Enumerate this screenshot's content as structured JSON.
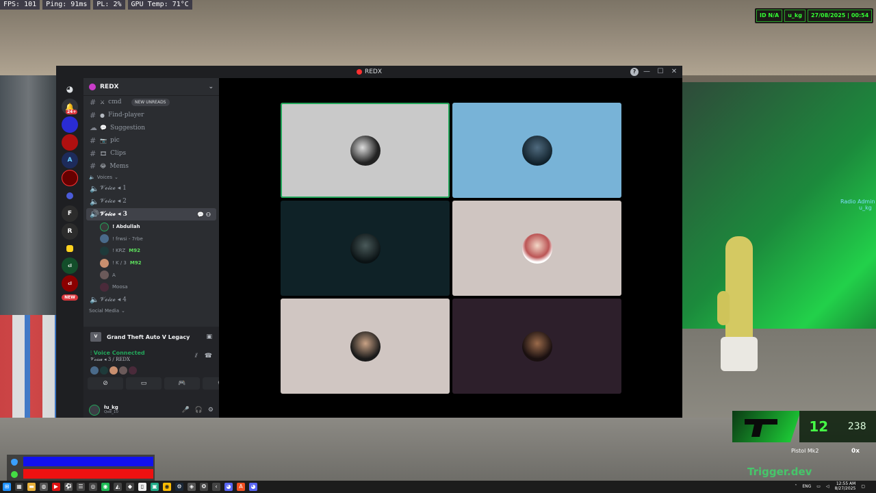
{
  "hud": {
    "fps": "FPS: 101",
    "ping": "Ping: 91ms",
    "pl": "PL: 2%",
    "gpu": "GPU Temp: 71°C",
    "badge_id": "ID N/A",
    "badge_user": "u_kg",
    "badge_datetime": "27/08/2025 | 00:54",
    "radio_label": "Radio Admin",
    "radio_user": "u_kg",
    "weapon_name": "Pistol Mk2",
    "ammo_clip": "12",
    "ammo_total": "238",
    "weapon_ox": "0x",
    "bottom_text": "Trigger.dev"
  },
  "discord": {
    "window_title": "REDX",
    "guild_name": "REDX",
    "new_unreads": "NEW UNREADS",
    "text_channels": [
      {
        "name": "cmd",
        "emoji": "⚔"
      },
      {
        "name": "Find-player",
        "emoji": "●"
      },
      {
        "name": "Suggestion",
        "emoji": "💬"
      },
      {
        "name": "pic",
        "emoji": "📷"
      },
      {
        "name": "Clips",
        "emoji": "🎞"
      },
      {
        "name": "Mems",
        "emoji": "😂"
      }
    ],
    "voice_category": "Voices",
    "voice_channels": [
      {
        "name": "𝓥𝓸𝓲𝓬𝓮 ◂ 1"
      },
      {
        "name": "𝓥𝓸𝓲𝓬𝓮 ◂ 2"
      },
      {
        "name": "𝓥𝓸𝓲𝓬𝓮 ◂ 3"
      },
      {
        "name": "𝓥𝓸𝓲𝓬𝓮 ◂ 4"
      }
    ],
    "members": [
      {
        "name": "! Abdullah",
        "tag": ""
      },
      {
        "name": "! frwsi - 7rbe",
        "tag": ""
      },
      {
        "name": "! KRZ",
        "tag": "M92"
      },
      {
        "name": "! K / 3",
        "tag": "M92"
      },
      {
        "name": "A",
        "tag": ""
      },
      {
        "name": "Moosa",
        "tag": ""
      }
    ],
    "social_category": "Social Media",
    "activity_game": "Grand Theft Auto V Legacy",
    "vc_status": "Voice Connected",
    "vc_channel": "𝓥𝓸𝓲𝓬𝓮 ◂ 3 / REDX",
    "user_name": "łu_kg",
    "user_sub": "Qee_10",
    "server_badge_count": "24+",
    "server_new": "NEW"
  },
  "tile_colors": [
    "#c9c9c9",
    "#78b3d7",
    "#0f2227",
    "#cfc5c1",
    "#d0c6c2",
    "#2d1f2b"
  ],
  "taskbar": {
    "time": "12:55 AM",
    "date": "8/27/2025",
    "lang": "ENG"
  }
}
